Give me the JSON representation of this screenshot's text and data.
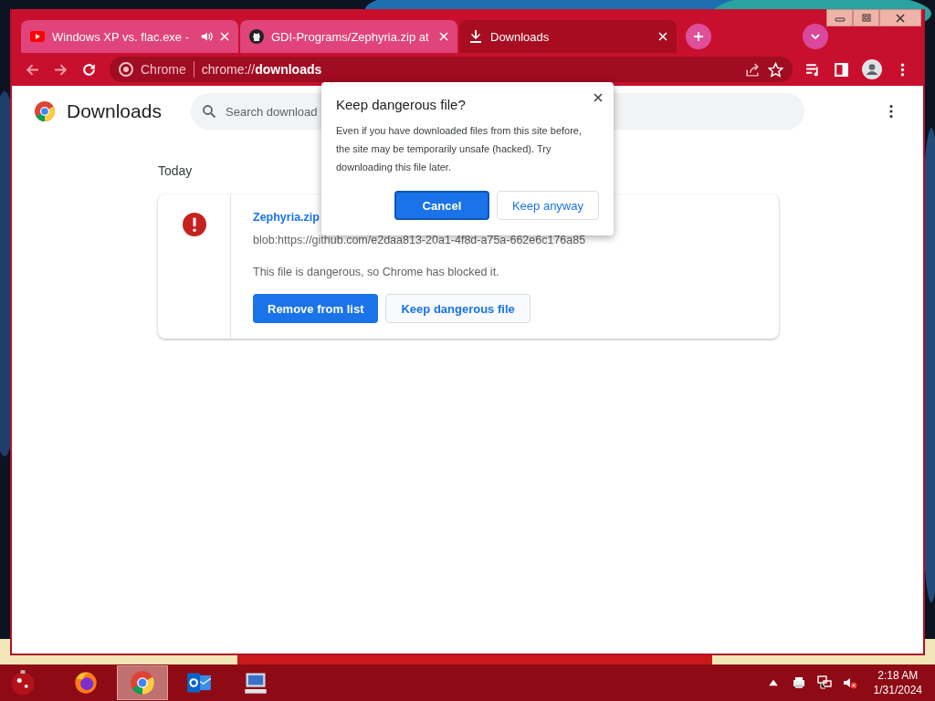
{
  "browser": {
    "tabs": [
      {
        "title": "Windows XP vs. flac.exe -",
        "audio_playing": true,
        "selected": false
      },
      {
        "title": "GDI-Programs/Zephyria.zip at",
        "audio_playing": false,
        "selected": false
      },
      {
        "title": "Downloads",
        "audio_playing": false,
        "selected": true
      }
    ],
    "omnibox": {
      "site_label": "Chrome",
      "url": "chrome://**downloads**"
    }
  },
  "page": {
    "title": "Downloads",
    "search": {
      "placeholder": "Search download"
    },
    "section": "Today",
    "download": {
      "file_name": "Zephyria.zip",
      "source": "blob:https://github.com/e2daa813-20a1-4f8d-a75a-662e6c176a85",
      "status": "This file is dangerous, so Chrome has blocked it.",
      "buttons": [
        "Remove from list",
        "Keep dangerous file"
      ]
    }
  },
  "dialog": {
    "title": "Keep dangerous file?",
    "message": "Even if you have downloaded files from this site before, the site may be temporarily unsafe (hacked). Try downloading this file later.",
    "buttons": [
      "Cancel",
      "Keep anyway"
    ]
  },
  "taskbar": {
    "apps": [
      {
        "selected": false
      },
      {
        "selected": true
      },
      {
        "selected": false
      },
      {
        "selected": false
      }
    ],
    "clock": {
      "time": "2:18 AM",
      "date": "1/31/2024"
    }
  }
}
